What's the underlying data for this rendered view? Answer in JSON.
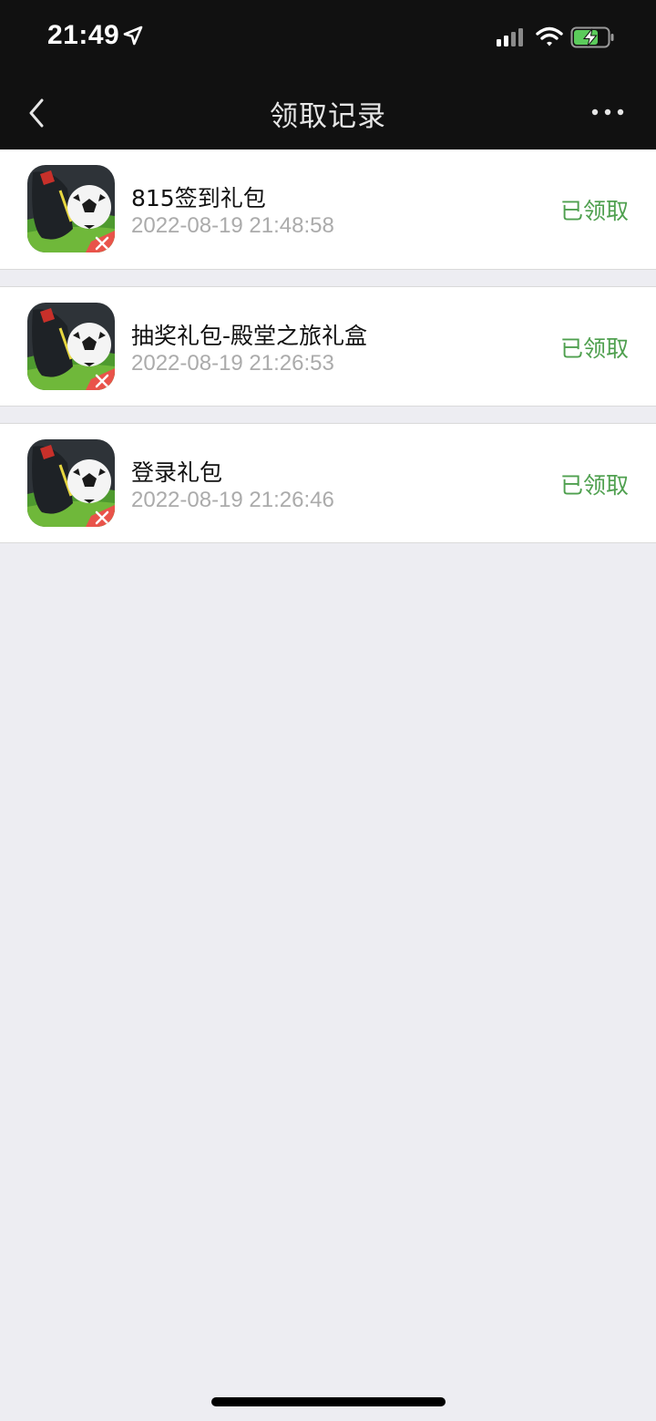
{
  "status_bar": {
    "time": "21:49",
    "icons": [
      "location-arrow-icon",
      "cellular-signal-icon",
      "wifi-icon",
      "battery-charging-icon"
    ]
  },
  "nav": {
    "title": "领取记录",
    "back_icon": "chevron-left-icon",
    "more_icon": "ellipsis-icon"
  },
  "records": [
    {
      "title": "815签到礼包",
      "time": "2022-08-19 21:48:58",
      "status": "已领取",
      "icon": "football-game-app-icon"
    },
    {
      "title": "抽奖礼包-殿堂之旅礼盒",
      "time": "2022-08-19 21:26:53",
      "status": "已领取",
      "icon": "football-game-app-icon"
    },
    {
      "title": "登录礼包",
      "time": "2022-08-19 21:26:46",
      "status": "已领取",
      "icon": "football-game-app-icon"
    }
  ],
  "colors": {
    "header_bg": "#111111",
    "page_bg": "#EDEDF2",
    "status_green": "#4FA04F",
    "battery_green": "#5BCB5B"
  }
}
